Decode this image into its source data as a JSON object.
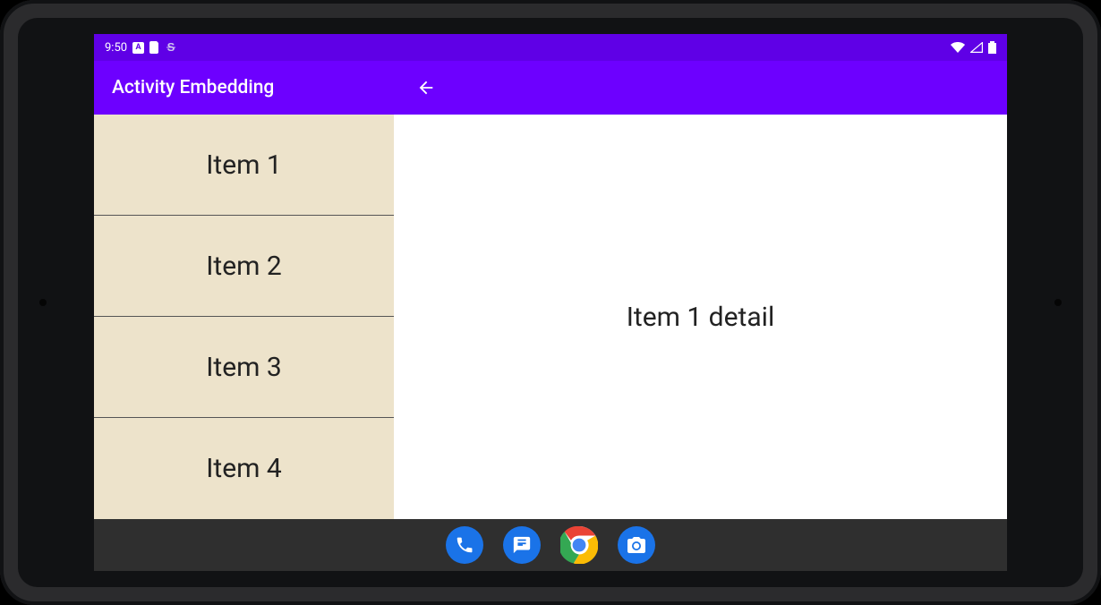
{
  "status_bar": {
    "time": "9:50",
    "left_icons": [
      "A",
      "card",
      "S"
    ],
    "right_icons": [
      "wifi",
      "signal",
      "battery"
    ]
  },
  "app_bar": {
    "title": "Activity Embedding",
    "back_icon": "arrow-back"
  },
  "list": {
    "items": [
      {
        "label": "Item 1"
      },
      {
        "label": "Item 2"
      },
      {
        "label": "Item 3"
      },
      {
        "label": "Item 4"
      }
    ]
  },
  "detail": {
    "text": "Item 1 detail"
  },
  "nav_bar": {
    "apps": [
      {
        "name": "phone"
      },
      {
        "name": "messages"
      },
      {
        "name": "chrome"
      },
      {
        "name": "camera"
      }
    ]
  }
}
